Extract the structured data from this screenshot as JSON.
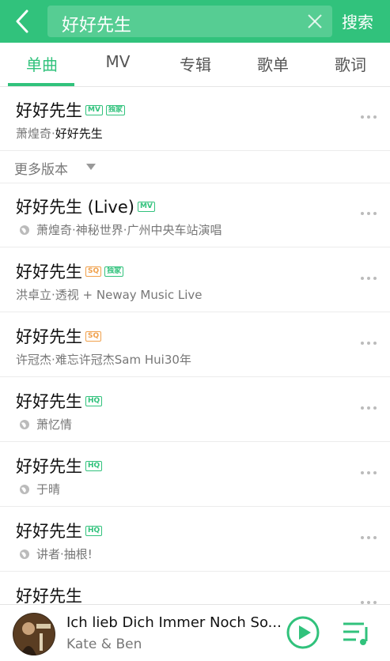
{
  "header": {
    "query": "好好先生",
    "search_label": "搜索",
    "accent": "#31c27c"
  },
  "tabs": [
    {
      "label": "单曲"
    },
    {
      "label": "MV"
    },
    {
      "label": "专辑"
    },
    {
      "label": "歌单"
    },
    {
      "label": "歌词"
    }
  ],
  "versions_label": "更多版本",
  "songs": [
    {
      "title": "好好先生",
      "sub_pre": "萧煌奇·",
      "sub_strong": "好好先生",
      "badges": [
        "MV",
        "独家"
      ],
      "globe": false
    },
    {
      "title": "好好先生 (Live)",
      "sub_pre": "萧煌奇·神秘世界·广州中央车站演唱",
      "badges": [
        "MV"
      ],
      "globe": true
    },
    {
      "title": "好好先生",
      "sub_pre": "洪卓立·透视 + Neway Music Live",
      "badges": [
        "SQ",
        "独家"
      ],
      "globe": false
    },
    {
      "title": "好好先生",
      "sub_pre": "许冠杰·难忘许冠杰Sam Hui30年",
      "badges": [
        "SQ"
      ],
      "globe": false
    },
    {
      "title": "好好先生",
      "sub_pre": "萧忆情",
      "badges": [
        "HQ"
      ],
      "globe": true
    },
    {
      "title": "好好先生",
      "sub_pre": "于晴",
      "badges": [
        "HQ"
      ],
      "globe": true
    },
    {
      "title": "好好先生",
      "sub_pre": "讲者·抽根!",
      "badges": [
        "HQ"
      ],
      "globe": true
    },
    {
      "title": "好好先生",
      "sub_pre": "",
      "badges": [],
      "globe": false
    }
  ],
  "player": {
    "title": "Ich lieb Dich Immer Noch So...",
    "artist": "Kate & Ben"
  }
}
